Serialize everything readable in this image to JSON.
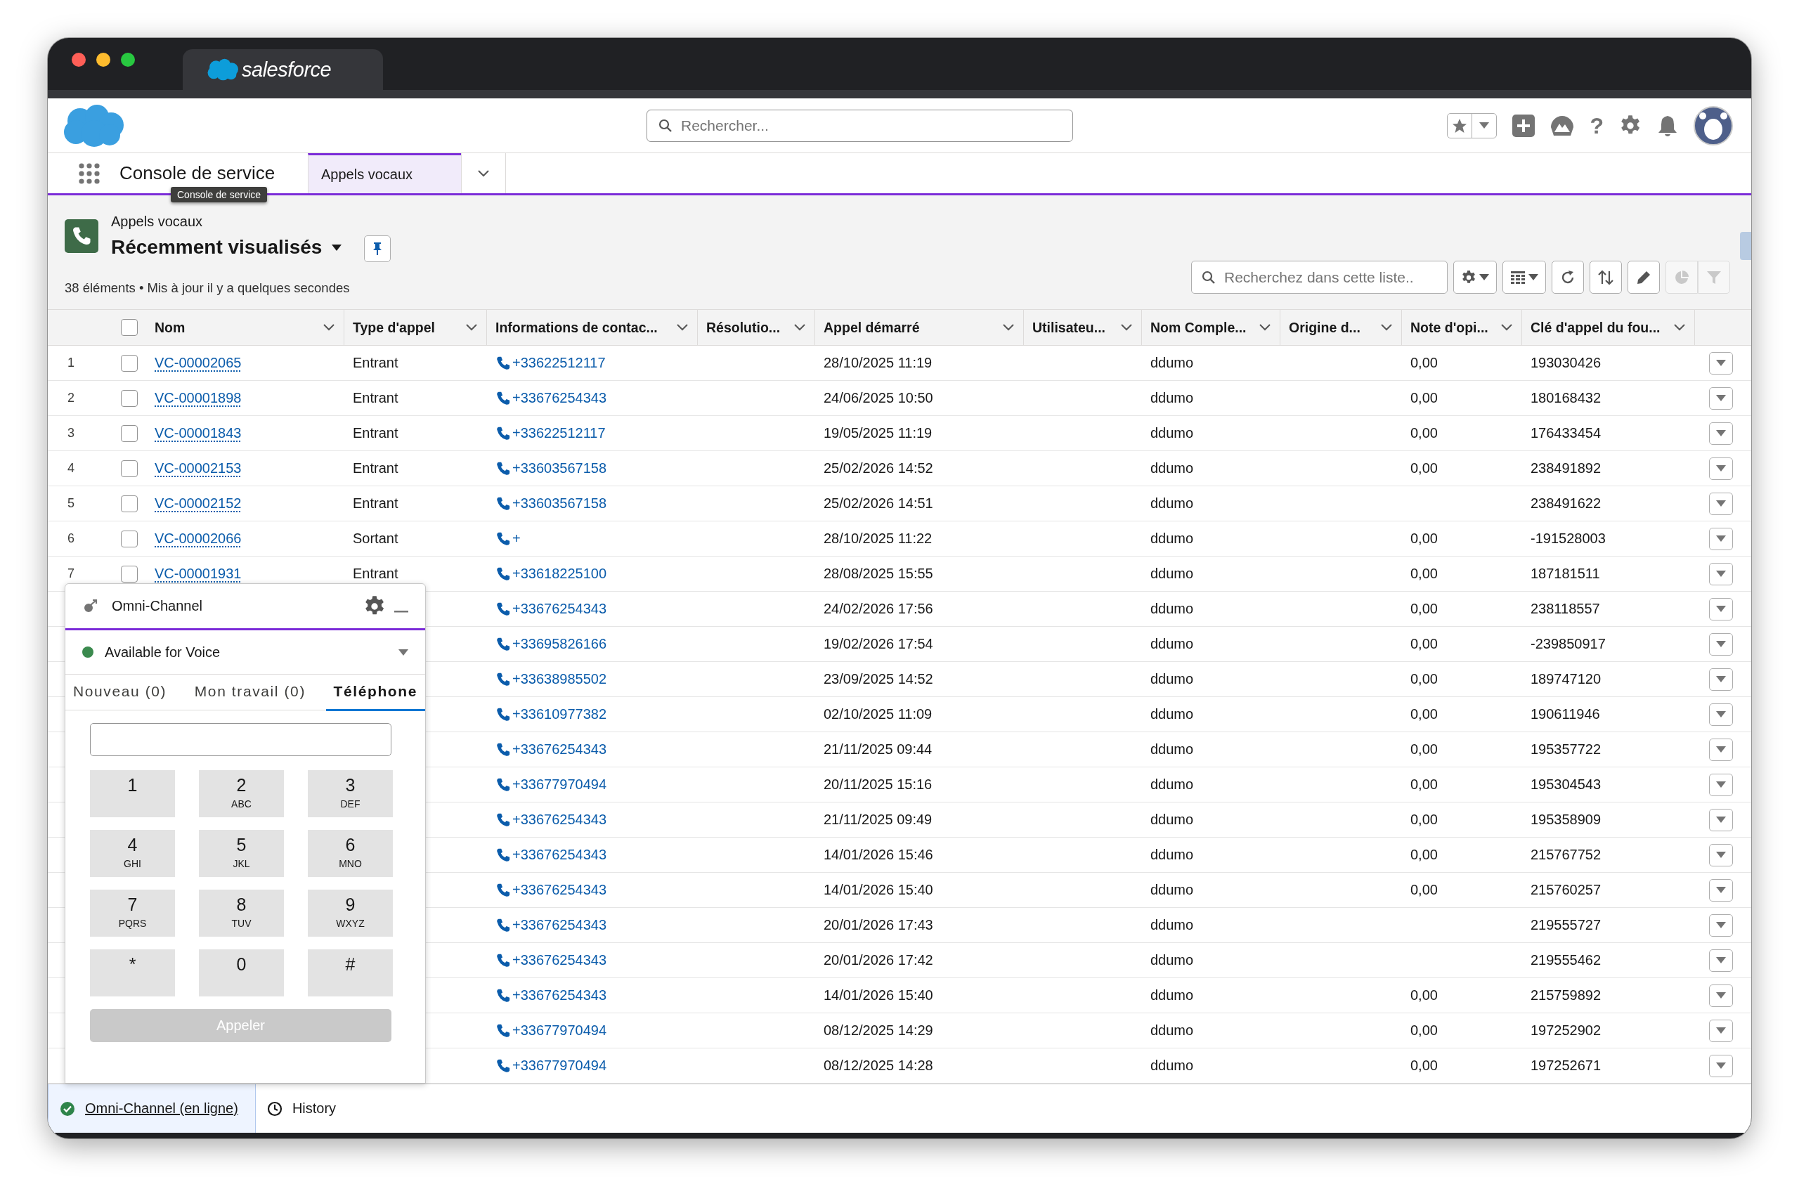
{
  "browser": {
    "tab_title": "salesforce"
  },
  "header": {
    "search": {
      "placeholder": "Rechercher..."
    },
    "help_glyph": "?"
  },
  "nav": {
    "app_name": "Console de service",
    "tooltip": "Console de service",
    "tabs": [
      {
        "label": "Appels vocaux",
        "selected": true
      }
    ]
  },
  "list_view": {
    "object_name": "Appels vocaux",
    "title": "Récemment visualisés",
    "summary": "38 éléments • Mis à jour il y a quelques secondes",
    "search": {
      "placeholder": "Recherchez dans cette liste.."
    },
    "toolbar": [
      {
        "kind": "settings",
        "disabled": false
      },
      {
        "kind": "columns",
        "disabled": false
      },
      {
        "kind": "refresh",
        "disabled": false
      },
      {
        "kind": "sort",
        "disabled": false
      },
      {
        "kind": "edit",
        "disabled": false
      },
      {
        "kind": "chart",
        "disabled": true
      },
      {
        "kind": "filter",
        "disabled": true
      }
    ]
  },
  "table": {
    "select_all": {
      "checked": false
    },
    "columns": [
      "Nom",
      "Type d'appel",
      "Informations de contac...",
      "Résolutio...",
      "Appel démarré",
      "Utilisateu...",
      "Nom Comple...",
      "Origine d...",
      "Note d'opi...",
      "Clé d'appel du fou..."
    ],
    "rows": [
      {
        "number": "1",
        "checked": false,
        "name": "VC-00002065",
        "call_type": "Entrant",
        "contact": "+33622512117",
        "started": "28/10/2025 11:19",
        "full_name": "ddumo",
        "rating": "0,00",
        "provider_key": "193030426"
      },
      {
        "number": "2",
        "checked": false,
        "name": "VC-00001898",
        "call_type": "Entrant",
        "contact": "+33676254343",
        "started": "24/06/2025 10:50",
        "full_name": "ddumo",
        "rating": "0,00",
        "provider_key": "180168432"
      },
      {
        "number": "3",
        "checked": false,
        "name": "VC-00001843",
        "call_type": "Entrant",
        "contact": "+33622512117",
        "started": "19/05/2025 11:19",
        "full_name": "ddumo",
        "rating": "0,00",
        "provider_key": "176433454"
      },
      {
        "number": "4",
        "checked": false,
        "name": "VC-00002153",
        "call_type": "Entrant",
        "contact": "+33603567158",
        "started": "25/02/2026 14:52",
        "full_name": "ddumo",
        "rating": "0,00",
        "provider_key": "238491892"
      },
      {
        "number": "5",
        "checked": false,
        "name": "VC-00002152",
        "call_type": "Entrant",
        "contact": "+33603567158",
        "started": "25/02/2026 14:51",
        "full_name": "ddumo",
        "provider_key": "238491622"
      },
      {
        "number": "6",
        "checked": false,
        "name": "VC-00002066",
        "call_type": "Sortant",
        "contact": "+",
        "started": "28/10/2025 11:22",
        "full_name": "ddumo",
        "rating": "0,00",
        "provider_key": "-191528003"
      },
      {
        "number": "7",
        "checked": false,
        "name": "VC-00001931",
        "call_type": "Entrant",
        "contact": "+33618225100",
        "started": "28/08/2025 15:55",
        "full_name": "ddumo",
        "rating": "0,00",
        "provider_key": "187181511"
      },
      {
        "contact": "+33676254343",
        "started": "24/02/2026 17:56",
        "full_name": "ddumo",
        "rating": "0,00",
        "provider_key": "238118557"
      },
      {
        "contact": "+33695826166",
        "started": "19/02/2026 17:54",
        "full_name": "ddumo",
        "rating": "0,00",
        "provider_key": "-239850917"
      },
      {
        "contact": "+33638985502",
        "started": "23/09/2025 14:52",
        "full_name": "ddumo",
        "rating": "0,00",
        "provider_key": "189747120"
      },
      {
        "contact": "+33610977382",
        "started": "02/10/2025 11:09",
        "full_name": "ddumo",
        "rating": "0,00",
        "provider_key": "190611946"
      },
      {
        "contact": "+33676254343",
        "started": "21/11/2025 09:44",
        "full_name": "ddumo",
        "rating": "0,00",
        "provider_key": "195357722"
      },
      {
        "contact": "+33677970494",
        "started": "20/11/2025 15:16",
        "full_name": "ddumo",
        "rating": "0,00",
        "provider_key": "195304543"
      },
      {
        "contact": "+33676254343",
        "started": "21/11/2025 09:49",
        "full_name": "ddumo",
        "rating": "0,00",
        "provider_key": "195358909"
      },
      {
        "contact": "+33676254343",
        "started": "14/01/2026 15:46",
        "full_name": "ddumo",
        "rating": "0,00",
        "provider_key": "215767752"
      },
      {
        "contact": "+33676254343",
        "started": "14/01/2026 15:40",
        "full_name": "ddumo",
        "rating": "0,00",
        "provider_key": "215760257"
      },
      {
        "contact": "+33676254343",
        "started": "20/01/2026 17:43",
        "full_name": "ddumo",
        "provider_key": "219555727"
      },
      {
        "contact": "+33676254343",
        "started": "20/01/2026 17:42",
        "full_name": "ddumo",
        "provider_key": "219555462"
      },
      {
        "contact": "+33676254343",
        "started": "14/01/2026 15:40",
        "full_name": "ddumo",
        "rating": "0,00",
        "provider_key": "215759892"
      },
      {
        "contact": "+33677970494",
        "started": "08/12/2025 14:29",
        "full_name": "ddumo",
        "rating": "0,00",
        "provider_key": "197252902"
      },
      {
        "contact": "+33677970494",
        "started": "08/12/2025 14:28",
        "full_name": "ddumo",
        "rating": "0,00",
        "provider_key": "197252671"
      }
    ]
  },
  "omni_channel": {
    "title": "Omni-Channel",
    "status": "Available for Voice",
    "tabs": [
      {
        "label": "Nouveau (0)",
        "selected": false
      },
      {
        "label": "Mon travail (0)",
        "selected": false
      },
      {
        "label": "Téléphone",
        "selected": true
      }
    ],
    "keys": [
      {
        "digit": "1"
      },
      {
        "digit": "2",
        "letters": "ABC"
      },
      {
        "digit": "3",
        "letters": "DEF"
      },
      {
        "digit": "4",
        "letters": "GHI"
      },
      {
        "digit": "5",
        "letters": "JKL"
      },
      {
        "digit": "6",
        "letters": "MNO"
      },
      {
        "digit": "7",
        "letters": "PQRS"
      },
      {
        "digit": "8",
        "letters": "TUV"
      },
      {
        "digit": "9",
        "letters": "WXYZ"
      },
      {
        "digit": "*"
      },
      {
        "digit": "0"
      },
      {
        "digit": "#"
      }
    ],
    "call_button": {
      "label": "Appeler",
      "disabled": true
    }
  },
  "utility_bar": {
    "items": [
      {
        "kind": "omni",
        "label": "Omni-Channel (en ligne)",
        "selected": true
      },
      {
        "kind": "history",
        "label": "History",
        "selected": false
      }
    ]
  }
}
